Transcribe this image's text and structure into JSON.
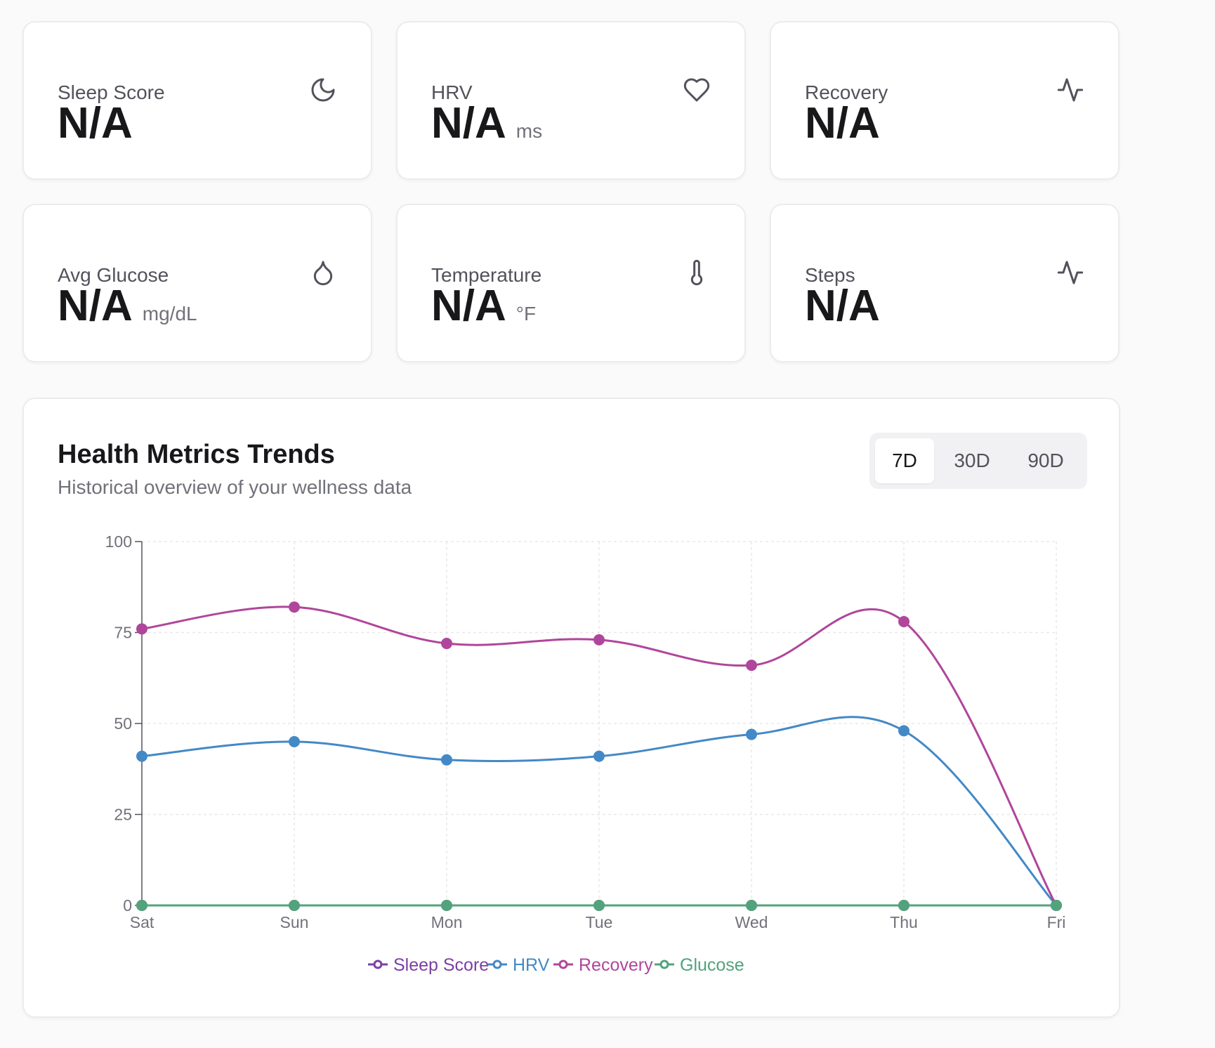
{
  "metrics": [
    {
      "label": "Sleep Score",
      "value": "N/A",
      "unit": "",
      "icon": "moon-icon"
    },
    {
      "label": "HRV",
      "value": "N/A",
      "unit": "ms",
      "icon": "heart-icon"
    },
    {
      "label": "Recovery",
      "value": "N/A",
      "unit": "",
      "icon": "activity-icon"
    },
    {
      "label": "Avg Glucose",
      "value": "N/A",
      "unit": "mg/dL",
      "icon": "droplet-icon"
    },
    {
      "label": "Temperature",
      "value": "N/A",
      "unit": "°F",
      "icon": "thermometer-icon"
    },
    {
      "label": "Steps",
      "value": "N/A",
      "unit": "",
      "icon": "activity-icon"
    }
  ],
  "trends": {
    "title": "Health Metrics Trends",
    "subtitle": "Historical overview of your wellness data",
    "ranges": [
      {
        "label": "7D",
        "active": true
      },
      {
        "label": "30D",
        "active": false
      },
      {
        "label": "90D",
        "active": false
      }
    ]
  },
  "chart_data": {
    "type": "line",
    "categories": [
      "Sat",
      "Sun",
      "Mon",
      "Tue",
      "Wed",
      "Thu",
      "Fri"
    ],
    "ylim": [
      0,
      100
    ],
    "yticks": [
      0,
      25,
      50,
      75,
      100
    ],
    "grid": true,
    "legend": "bottom",
    "series": [
      {
        "name": "Sleep Score",
        "color": "#7b3fa4",
        "values": [
          0,
          0,
          0,
          0,
          0,
          0,
          0
        ]
      },
      {
        "name": "HRV",
        "color": "#4389c6",
        "values": [
          41,
          45,
          40,
          41,
          47,
          48,
          0
        ]
      },
      {
        "name": "Recovery",
        "color": "#b0469b",
        "values": [
          76,
          82,
          72,
          73,
          66,
          78,
          0
        ]
      },
      {
        "name": "Glucose",
        "color": "#52a37c",
        "values": [
          0,
          0,
          0,
          0,
          0,
          0,
          0
        ]
      }
    ]
  }
}
